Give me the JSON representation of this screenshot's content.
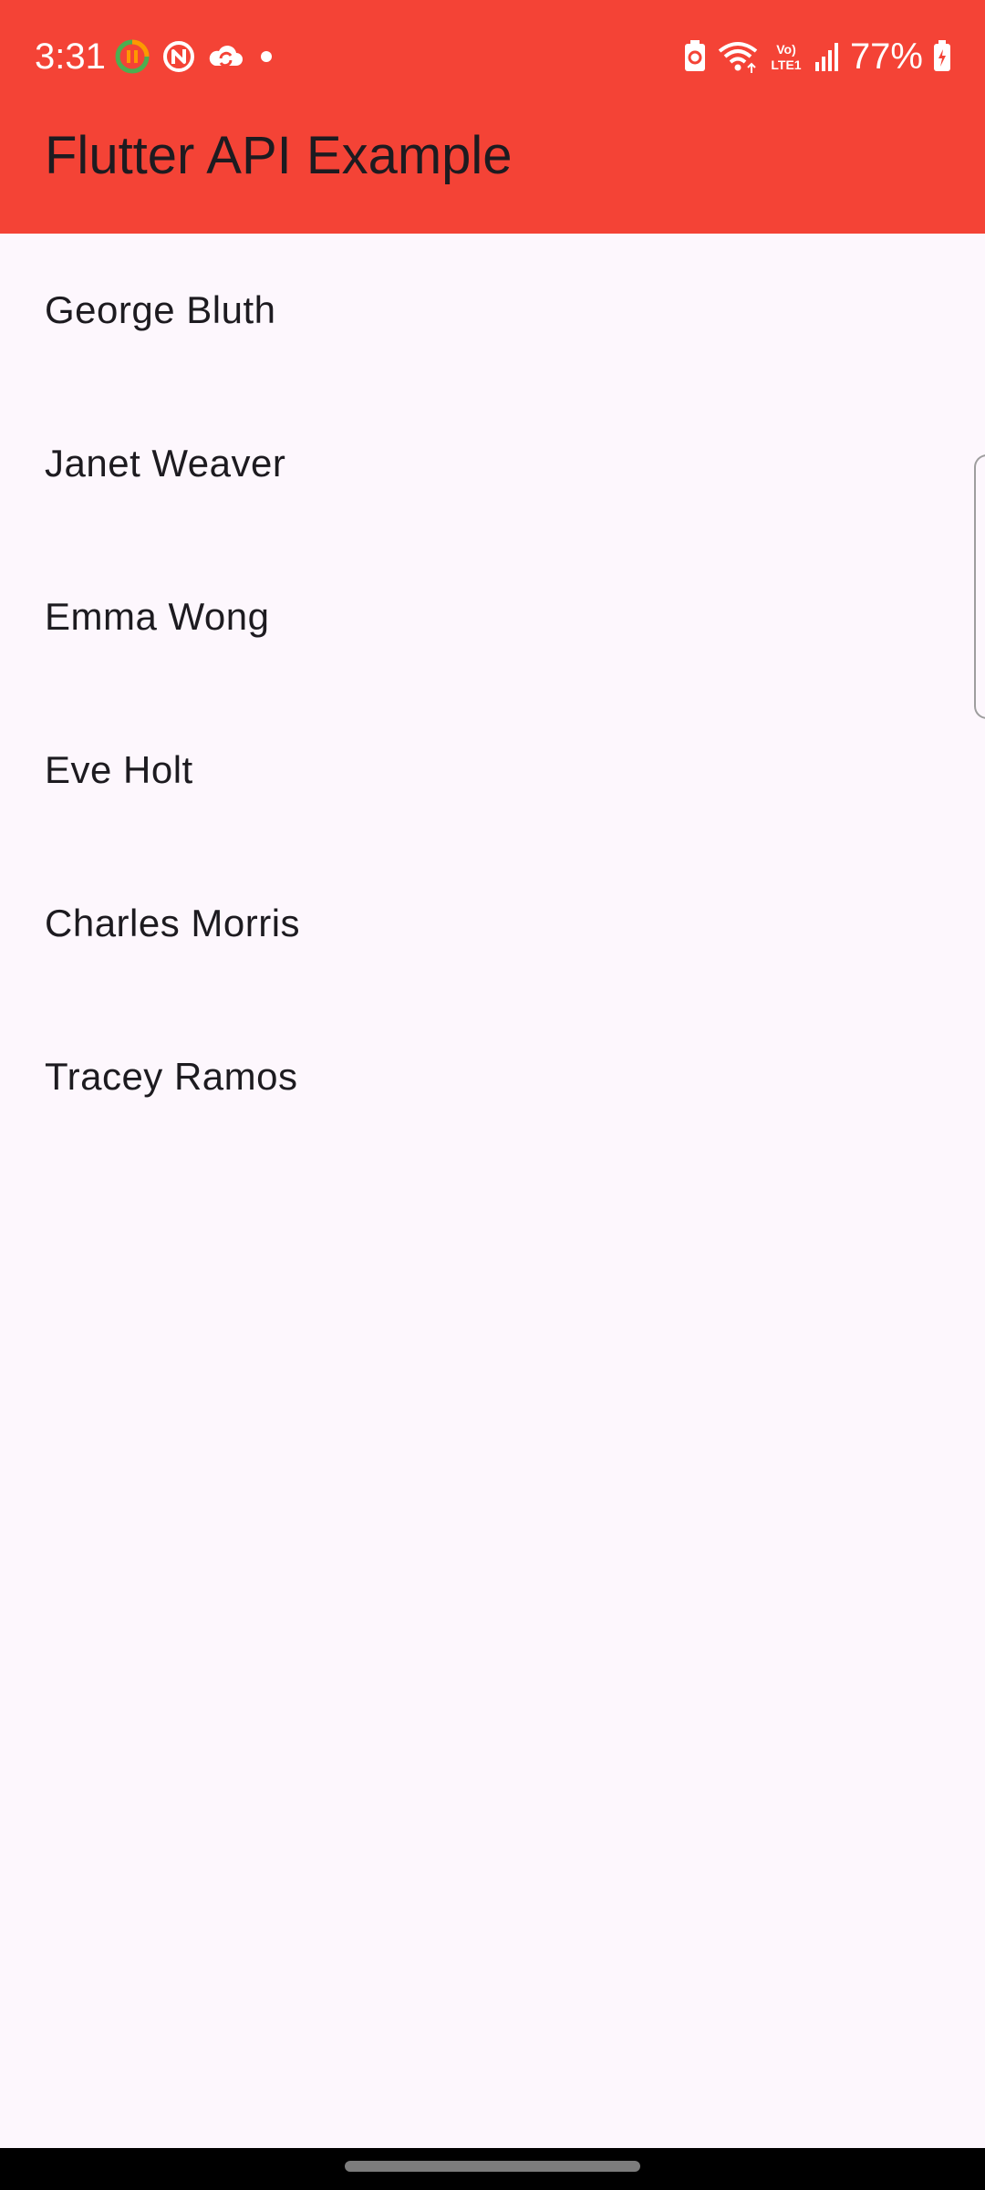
{
  "status_bar": {
    "time": "3:31",
    "battery_percent": "77%",
    "left_icons": [
      "vpn-app-icon",
      "app-notification-icon",
      "cloud-sync-icon",
      "dot-icon"
    ],
    "right_icons": [
      "battery-saver-icon",
      "wifi-icon",
      "volte-icon",
      "signal-icon",
      "battery-icon"
    ],
    "network_label": "Vo) LTE1"
  },
  "app_bar": {
    "title": "Flutter API Example",
    "color": "#f44336"
  },
  "users": [
    {
      "name": "George Bluth"
    },
    {
      "name": "Janet Weaver"
    },
    {
      "name": "Emma Wong"
    },
    {
      "name": "Eve Holt"
    },
    {
      "name": "Charles Morris"
    },
    {
      "name": "Tracey Ramos"
    }
  ],
  "colors": {
    "background": "#fdf7fd",
    "text": "#1d1b20",
    "nav_bar": "#000000"
  }
}
